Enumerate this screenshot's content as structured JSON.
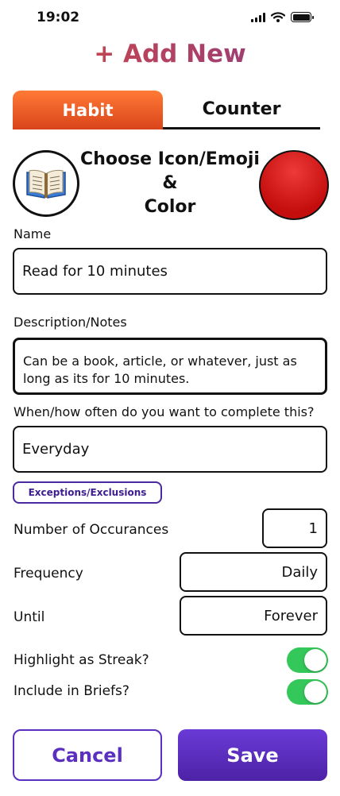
{
  "status_bar": {
    "time": "19:02",
    "icons": [
      "signal-icon",
      "wifi-icon",
      "battery-icon"
    ]
  },
  "title": "+ Add New",
  "tabs": {
    "habit": "Habit",
    "counter": "Counter",
    "active": "habit"
  },
  "chooser": {
    "line1": "Choose Icon/Emoji",
    "line2": "&",
    "line3": "Color",
    "emoji": "📖",
    "color": "#d71b1b"
  },
  "name": {
    "label": "Name",
    "value": "Read for 10 minutes"
  },
  "description": {
    "label": "Description/Notes",
    "value": "Can be a book, article, or whatever, just as long as its for 10 minutes."
  },
  "schedule": {
    "label": "When/how often do you want to complete this?",
    "value": "Everyday",
    "exceptions_label": "Exceptions/Exclusions"
  },
  "occurrences": {
    "label": "Number of Occurances",
    "value": "1"
  },
  "frequency": {
    "label": "Frequency",
    "value": "Daily"
  },
  "until": {
    "label": "Until",
    "value": "Forever"
  },
  "toggles": {
    "streak": {
      "label": "Highlight as Streak?",
      "on": true
    },
    "briefs": {
      "label": "Include in Briefs?",
      "on": true
    }
  },
  "buttons": {
    "cancel": "Cancel",
    "save": "Save"
  },
  "colors": {
    "accent": "#5b2fc0",
    "habit_tab": "#f06a2c",
    "toggle_on": "#34c759"
  }
}
